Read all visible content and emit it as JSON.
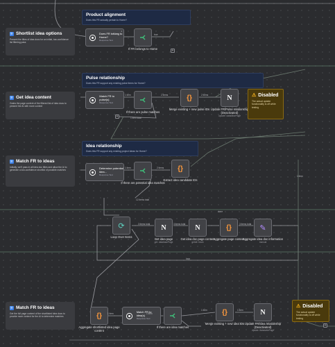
{
  "notes": [
    {
      "title": "Shortlist idea options",
      "body": "Present the titles of idea docs for an initial, low-confidence list filtering pass"
    },
    {
      "title": "Get idea content",
      "body": "Grabs the page content of the filtered list of idea docs to present the AI with more context"
    },
    {
      "title": "Match FR to ideas",
      "body": "Initially, we'll pass in all idea doc titles and allow the AI to generate a low-confidence shortlist of possible matches"
    },
    {
      "title": "Match FR to ideas",
      "body": "Get the full page content of the shortlisted idea docs to provide more context for the AI to determine matches"
    }
  ],
  "sections": [
    {
      "title": "Product alignment",
      "sub": "Does this FR actually pertain to Home?"
    },
    {
      "title": "Pulse relationship",
      "sub": "Does this FR support any existing pulse items for Home?"
    },
    {
      "title": "Idea relationship",
      "sub": "Does this FR support any existing project ideas for Home?"
    }
  ],
  "nodes": {
    "fr_home": {
      "title": "Does FR belong to Home?",
      "sub": "Response Text"
    },
    "if_home": {
      "label": "If FR belongs to Home"
    },
    "match_pulse": {
      "title": "Match FR to pulse(s)",
      "sub": "Response Text"
    },
    "if_pulse": {
      "label": "If there are pulse matches"
    },
    "merge_pulse": {
      "label": "Merge existing + new pulse IDs"
    },
    "update_pulse": {
      "label": "Update FR/Pulse relationship",
      "sub": "(Deactivated)",
      "sub2": "update: databasePage"
    },
    "determine_idea": {
      "title": "Determine potential idea...",
      "sub": "Response Text"
    },
    "if_potential": {
      "label": "If there are potential idea matches"
    },
    "extract_idea": {
      "label": "Extract idea candidate IDs"
    },
    "loop": {
      "label": "Loop Over Items"
    },
    "get_idea_page": {
      "label": "Get idea page",
      "sub": "get: databasePage"
    },
    "get_idea_doc": {
      "label": "Get idea doc page content",
      "sub": "getAll: block"
    },
    "aggregate_page": {
      "label": "Aggregate page content"
    },
    "aggregate_info": {
      "label": "Aggregate idea doc information",
      "sub": "manual"
    },
    "aggregate_short": {
      "label": "Aggregate shortlisted idea page content"
    },
    "match_ideas": {
      "title": "Match FR to idea(s)",
      "sub": "Response Text"
    },
    "if_idea": {
      "label": "If there are idea matches"
    },
    "merge_idea": {
      "label": "Merge existing + new idea IDs"
    },
    "update_idea": {
      "label": "Update FR/Idea relationship",
      "sub": "(Deactivated)",
      "sub2": "update: databasePage"
    }
  },
  "warnings": [
    {
      "title": "Disabled",
      "body": "The actual update functionality is off while testing"
    },
    {
      "title": "Disabled",
      "body": "The actual update functionality is off while testing"
    }
  ],
  "edge_labels": {
    "true": "true",
    "false": "false",
    "items1": "1 item",
    "items2": "2 items",
    "items2b": "2 items total",
    "items1t": "1 item total",
    "items4": "4 items",
    "items3": "3 items total",
    "items12": "12 items total",
    "done": "done",
    "loop": "loop",
    "items10": "10 items total",
    "item1total": "1 item total"
  },
  "counts": {
    "one": "1"
  }
}
